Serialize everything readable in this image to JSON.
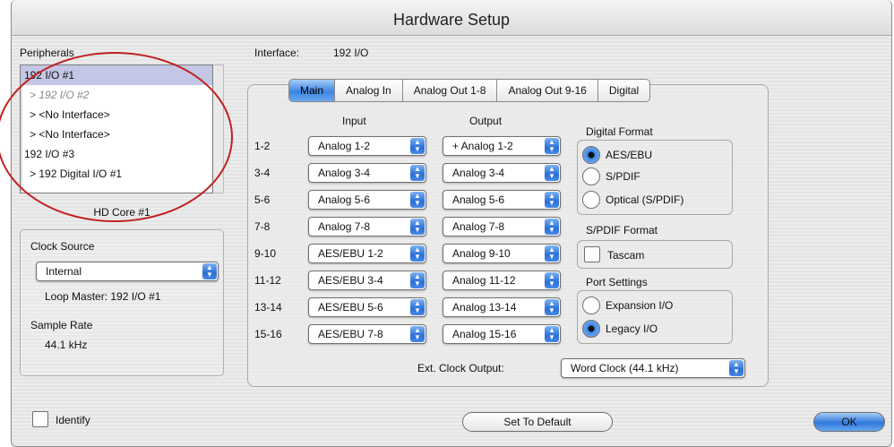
{
  "window": {
    "title": "Hardware Setup"
  },
  "peripherals": {
    "label": "Peripherals",
    "items": [
      {
        "label": "192 I/O #1",
        "state": "selected"
      },
      {
        "label": "> 192 I/O #2",
        "state": "disabled"
      },
      {
        "label": "> <No Interface>",
        "state": "normal"
      },
      {
        "label": "> <No Interface>",
        "state": "normal"
      },
      {
        "label": "192 I/O #3",
        "state": "normal"
      },
      {
        "label": "> 192 Digital I/O #1",
        "state": "normal"
      }
    ],
    "core_label": "HD Core #1"
  },
  "clock": {
    "label": "Clock Source",
    "source": "Internal",
    "loop_master": "Loop Master: 192 I/O #1",
    "sample_rate_label": "Sample Rate",
    "sample_rate_value": "44.1 kHz"
  },
  "interface": {
    "label": "Interface:",
    "value": "192 I/O"
  },
  "tabs": [
    "Main",
    "Analog In",
    "Analog Out 1-8",
    "Analog Out 9-16",
    "Digital"
  ],
  "io": {
    "input_header": "Input",
    "output_header": "Output",
    "rows": [
      {
        "label": "1-2",
        "input": "Analog 1-2",
        "output": "+ Analog 1-2"
      },
      {
        "label": "3-4",
        "input": "Analog 3-4",
        "output": "Analog 3-4"
      },
      {
        "label": "5-6",
        "input": "Analog 5-6",
        "output": "Analog 5-6"
      },
      {
        "label": "7-8",
        "input": "Analog 7-8",
        "output": "Analog 7-8"
      },
      {
        "label": "9-10",
        "input": "AES/EBU 1-2",
        "output": "Analog 9-10"
      },
      {
        "label": "11-12",
        "input": "AES/EBU 3-4",
        "output": "Analog 11-12"
      },
      {
        "label": "13-14",
        "input": "AES/EBU 5-6",
        "output": "Analog 13-14"
      },
      {
        "label": "15-16",
        "input": "AES/EBU 7-8",
        "output": "Analog 15-16"
      }
    ]
  },
  "digital_format": {
    "label": "Digital Format",
    "options": [
      "AES/EBU",
      "S/PDIF",
      "Optical (S/PDIF)"
    ],
    "selected": "AES/EBU"
  },
  "spdif_format": {
    "label": "S/PDIF Format",
    "tascam_label": "Tascam",
    "tascam_checked": false
  },
  "port_settings": {
    "label": "Port Settings",
    "options": [
      "Expansion I/O",
      "Legacy I/O"
    ],
    "selected": "Legacy I/O"
  },
  "ext_clock": {
    "label": "Ext. Clock Output:",
    "value": "Word Clock (44.1 kHz)"
  },
  "footer": {
    "identify_label": "Identify",
    "set_default_label": "Set To Default",
    "ok_label": "OK"
  },
  "colors": {
    "accent": "#3d85e3",
    "selection": "#c3c6e4",
    "annotation": "#c02020"
  }
}
